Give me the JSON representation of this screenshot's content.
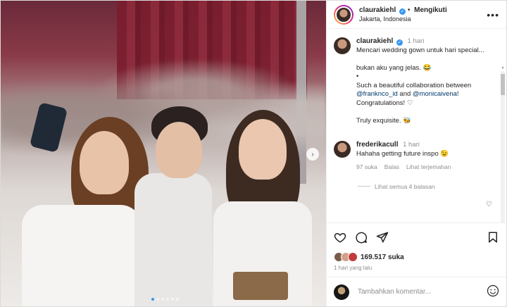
{
  "post": {
    "author": "claurakiehl",
    "follow_status": "Mengikuti",
    "location": "Jakarta, Indonesia",
    "caption_time": "1 hari",
    "caption_lines": [
      "Mencari wedding gown untuk hari special...",
      "",
      "bukan aku yang jelas. 😂",
      "•",
      "Such a beautiful collaboration between"
    ],
    "caption_tag1": "@franknco_id",
    "caption_and": " and ",
    "caption_tag2": "@monicaivena",
    "caption_after_tag": "! Congratulations! ♡",
    "caption_closing": "Truly exquisite. 🐝",
    "image_dots": 6,
    "image_active_dot": 0
  },
  "comment": {
    "username": "frederikacull",
    "time": "1 hari",
    "text": "Hahaha getting future inspo 😉",
    "likes": "97 suka",
    "reply_label": "Balas",
    "translate_label": "Lihat terjemahan",
    "see_replies": "Lihat semua 4 balasan"
  },
  "engagement": {
    "likes_count": "169.517",
    "likes_suffix": "suka",
    "date": "1 hari yang lalu"
  },
  "add_comment": {
    "placeholder": "Tambahkan komentar..."
  },
  "icons": {
    "like": "heart-icon",
    "comment": "comment-icon",
    "share": "share-icon",
    "save": "bookmark-icon",
    "emoji": "smiley-icon",
    "more": "more-options-icon",
    "next": "chevron-right-icon"
  },
  "colors": {
    "verified": "#3897f0",
    "link": "#00376b",
    "muted": "#8e8e8e"
  }
}
